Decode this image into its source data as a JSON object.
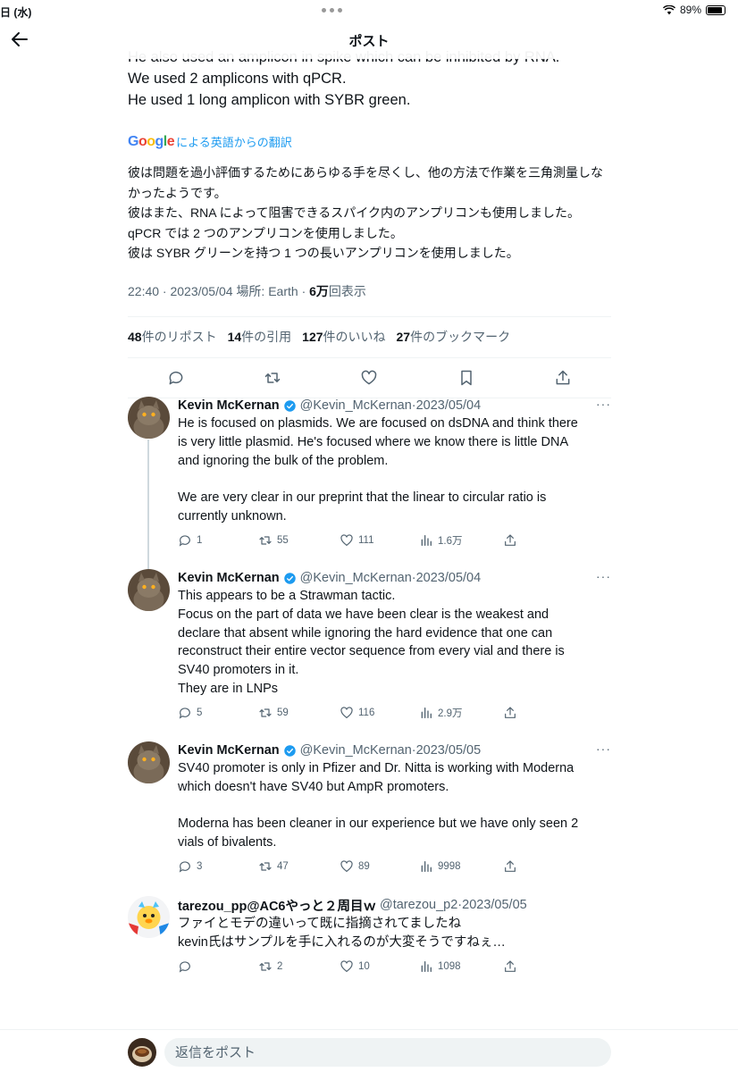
{
  "status": {
    "date": "日 (水)",
    "battery": "89%"
  },
  "header": {
    "title": "ポスト"
  },
  "post": {
    "original_lines": [
      "He also used an amplicon in spike which can be inhibited by RNA.",
      "We used 2 amplicons with qPCR.",
      "He used 1 long amplicon with SYBR green."
    ],
    "google": "Google",
    "translate_label": "による英語からの翻訳",
    "translated_lines": [
      "彼は問題を過小評価するためにあらゆる手を尽くし、他の方法で作業を三角測量しな",
      "かったようです。",
      "彼はまた、RNA によって阻害できるスパイク内のアンプリコンも使用しました。",
      "qPCR では 2 つのアンプリコンを使用しました。",
      "彼は SYBR グリーンを持つ 1 つの長いアンプリコンを使用しました。"
    ],
    "meta_prefix": "22:40 · 2023/05/04 場所: Earth · ",
    "views_count": "6万",
    "views_label": "回表示",
    "stats": [
      {
        "count": "48",
        "label": "件のリポスト"
      },
      {
        "count": "14",
        "label": "件の引用"
      },
      {
        "count": "127",
        "label": "件のいいね"
      },
      {
        "count": "27",
        "label": "件のブックマーク"
      }
    ]
  },
  "replies": [
    {
      "name": "Kevin McKernan",
      "handle": "@Kevin_McKernan",
      "sep": "·",
      "date": "2023/05/04",
      "lines": [
        "He is focused on plasmids. We are focused on dsDNA and think there",
        "is very little plasmid. He's focused where we know there is little DNA",
        "and ignoring the bulk of the problem.",
        "",
        "We are very clear in our preprint that the linear to circular ratio is",
        "currently unknown."
      ],
      "replies": "1",
      "reposts": "55",
      "likes": "111",
      "views": "1.6万"
    },
    {
      "name": "Kevin McKernan",
      "handle": "@Kevin_McKernan",
      "sep": "·",
      "date": "2023/05/04",
      "lines": [
        "This appears to be a Strawman tactic.",
        "Focus on the part of data we have been clear is the weakest and",
        "declare that absent while ignoring the hard evidence that one can",
        "reconstruct their entire vector sequence from every vial and there is",
        "SV40 promoters in it.",
        "They are in LNPs"
      ],
      "replies": "5",
      "reposts": "59",
      "likes": "116",
      "views": "2.9万"
    },
    {
      "name": "Kevin McKernan",
      "handle": "@Kevin_McKernan",
      "sep": "·",
      "date": "2023/05/05",
      "lines": [
        "SV40 promoter is only in Pfizer and Dr. Nitta is working with Moderna",
        "which doesn't have SV40 but AmpR promoters.",
        "",
        "Moderna has been cleaner in our experience but we have only seen 2",
        "vials of bivalents."
      ],
      "replies": "3",
      "reposts": "47",
      "likes": "89",
      "views": "9998"
    },
    {
      "name": "tarezou_pp@AC6やっと２周目ｗ",
      "handle": "@tarezou_p2",
      "sep": "·",
      "date": "2023/05/05",
      "lines": [
        "ファイとモデの違いって既に指摘されてましたね",
        "kevin氏はサンプルを手に入れるのが大変そうですねぇ…"
      ],
      "replies": "",
      "reposts": "2",
      "likes": "10",
      "views": "1098"
    }
  ],
  "reply_bar": {
    "placeholder": "返信をポスト"
  },
  "colors": {
    "accent": "#1d9bf0",
    "text": "#0f1419",
    "muted": "#536471",
    "border": "#eff3f4"
  }
}
